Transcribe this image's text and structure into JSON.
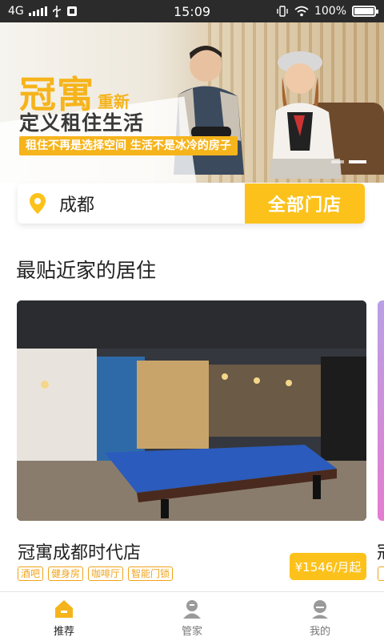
{
  "status_bar": {
    "network": "4G",
    "time": "15:09",
    "battery": "100%",
    "battery_level": 1.0
  },
  "banner": {
    "brand": "冠寓",
    "brand_suffix": "重新",
    "headline": "定义租住生活",
    "tagline": "租住不再是选择空间 生活不是冰冷的房子",
    "slide_count": 2,
    "active_slide": 1
  },
  "search": {
    "city": "成都",
    "all_stores_label": "全部门店"
  },
  "section": {
    "title": "最贴近家的居住"
  },
  "stores": [
    {
      "name": "冠寓成都时代店",
      "tags": [
        "酒吧",
        "健身房",
        "咖啡厅",
        "智能门锁"
      ],
      "price": "¥1546/月起"
    },
    {
      "name": "冠"
    }
  ],
  "tabbar": {
    "items": [
      {
        "label": "推荐",
        "icon": "home-icon",
        "active": true
      },
      {
        "label": "管家",
        "icon": "butler-icon",
        "active": false
      },
      {
        "label": "我的",
        "icon": "profile-icon",
        "active": false
      }
    ]
  },
  "colors": {
    "accent": "#fcc21b",
    "tag_text": "#f0a41b",
    "status_bar": "#2b2b2b",
    "tab_active": "#f6b41c",
    "tab_inactive": "#9a9a9a"
  }
}
